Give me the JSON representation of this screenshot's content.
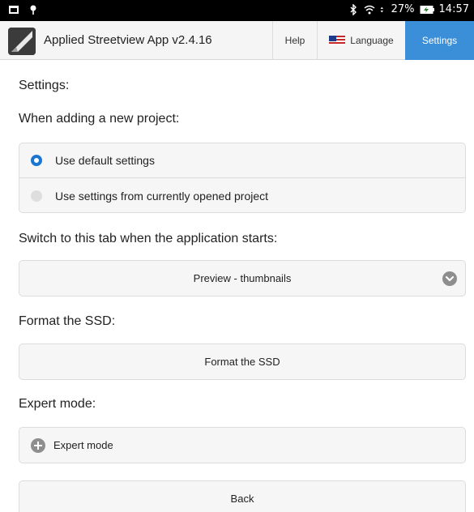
{
  "status_bar": {
    "battery_percent": "27%",
    "time": "14:57",
    "icons": [
      "gallery-icon",
      "location-pin-icon",
      "bluetooth-icon",
      "wifi-icon",
      "data-arrows-icon",
      "battery-icon"
    ]
  },
  "header": {
    "app_title": "Applied Streetview App v2.4.16",
    "nav": {
      "help": "Help",
      "language": "Language",
      "settings": "Settings"
    },
    "active_tab": "settings",
    "accent_color": "#3a8fd8"
  },
  "settings": {
    "title": "Settings:",
    "new_project": {
      "heading": "When adding a new project:",
      "options": [
        {
          "label": "Use default settings",
          "selected": true
        },
        {
          "label": "Use settings from currently opened project",
          "selected": false
        }
      ]
    },
    "start_tab": {
      "heading": "Switch to this tab when the application starts:",
      "selected": "Preview - thumbnails"
    },
    "format_ssd": {
      "heading": "Format the SSD:",
      "button": "Format the SSD"
    },
    "expert_mode": {
      "heading": "Expert mode:",
      "button": "Expert mode"
    },
    "back_button": "Back"
  }
}
